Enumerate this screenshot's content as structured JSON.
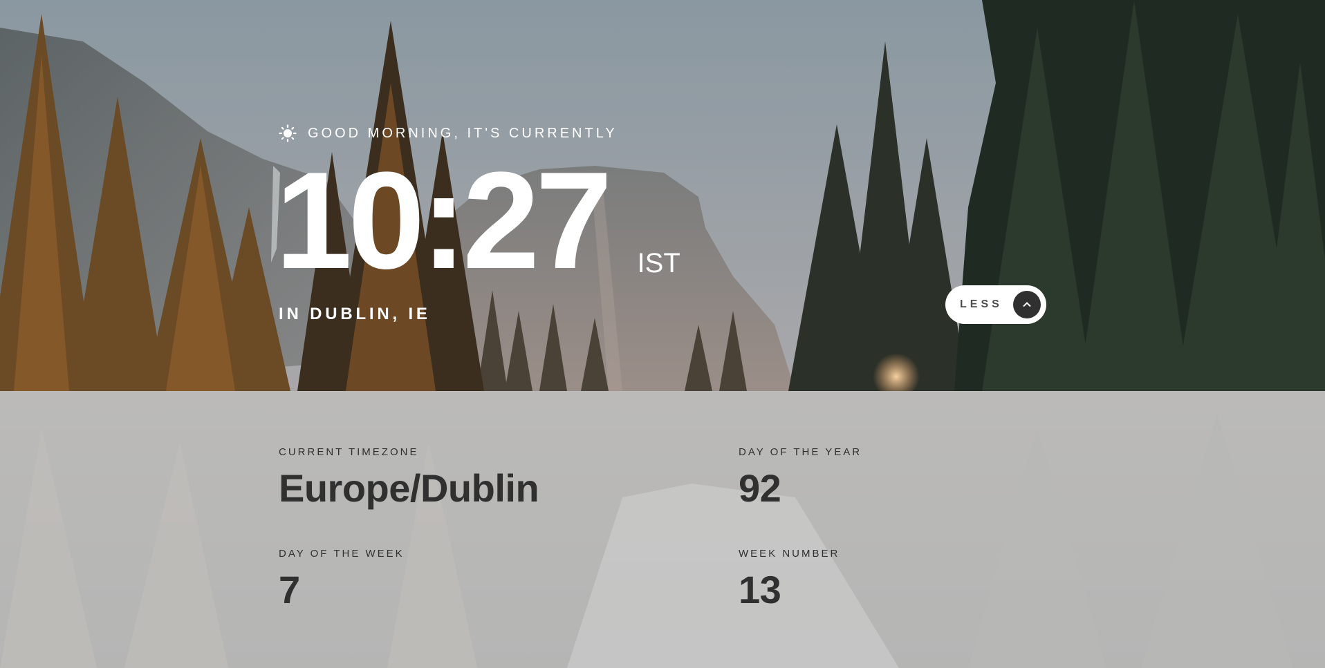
{
  "hero": {
    "greeting": "GOOD MORNING, IT'S CURRENTLY",
    "greeting_icon": "sun-icon",
    "time": "10:27",
    "timezone_abbr": "IST",
    "location": "IN DUBLIN, IE"
  },
  "toggle": {
    "label": "LESS",
    "icon": "chevron-up-icon"
  },
  "details": {
    "timezone": {
      "label": "CURRENT TIMEZONE",
      "value": "Europe/Dublin"
    },
    "day_of_year": {
      "label": "DAY OF THE YEAR",
      "value": "92"
    },
    "day_of_week": {
      "label": "DAY OF THE WEEK",
      "value": "7"
    },
    "week_number": {
      "label": "WEEK NUMBER",
      "value": "13"
    }
  },
  "colors": {
    "panel_text": "#303030",
    "button_bg": "#ffffff",
    "button_icon_bg": "#303030"
  }
}
